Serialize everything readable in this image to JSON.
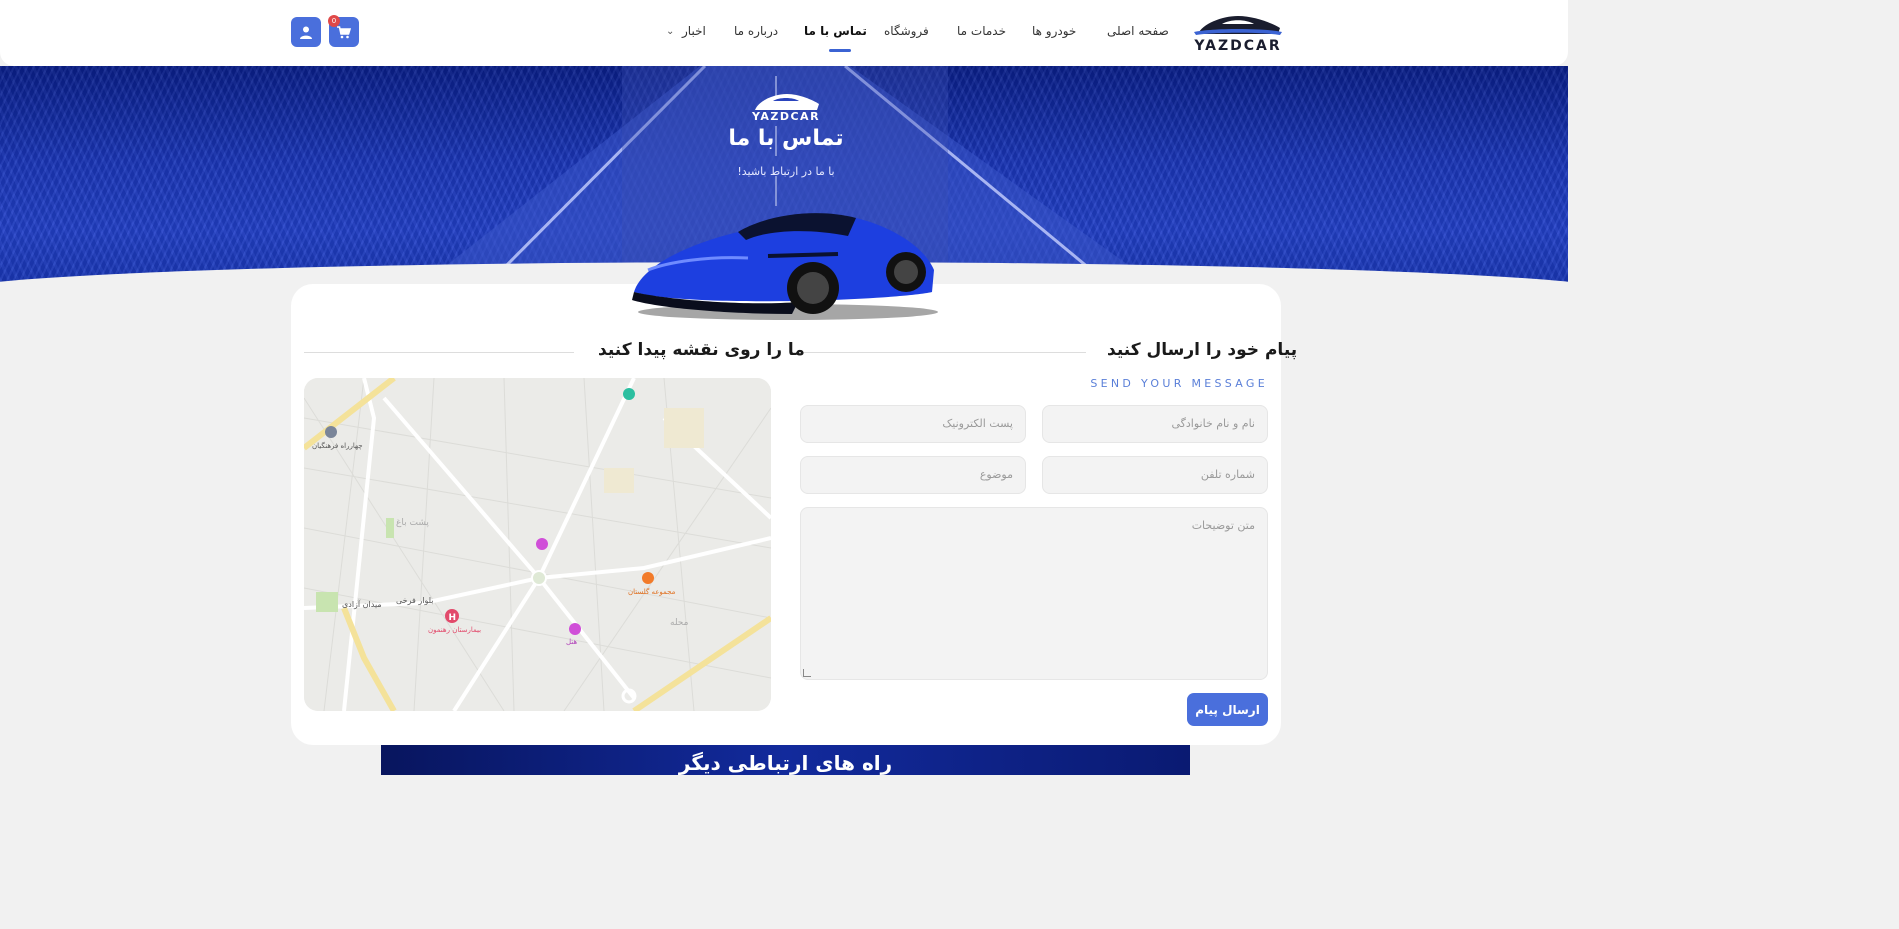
{
  "brand": {
    "name": "YAZDCAR"
  },
  "nav": {
    "items": [
      {
        "label": "صفحه اصلی"
      },
      {
        "label": "خودرو ها"
      },
      {
        "label": "خدمات ما"
      },
      {
        "label": "فروشگاه"
      },
      {
        "label": "تماس با ما",
        "active": true
      },
      {
        "label": "درباره ما"
      },
      {
        "label": "اخبار"
      }
    ],
    "cart_count": "0",
    "icons": {
      "cart": "cart-icon",
      "user": "user-icon",
      "dropdown": "chevron-down-icon"
    }
  },
  "hero": {
    "brand": "YAZDCAR",
    "title": "تماس با ما",
    "subtitle": "با ما در ارتباط باشید!"
  },
  "contact_form": {
    "title": "پیام خود را ارسال کنید",
    "subtitle": "SEND YOUR MESSAGE",
    "fields": {
      "full_name_placeholder": "نام و نام خانوادگی",
      "email_placeholder": "پست الکترونیک",
      "phone_placeholder": "شماره تلفن",
      "subject_placeholder": "موضوع",
      "message_placeholder": "متن توضیحات"
    },
    "submit_label": "ارسال پیام"
  },
  "map_section": {
    "title": "ما را روی نقشه پیدا کنید",
    "labels": {
      "square": "میدان آزادی",
      "boulevard": "بلوار فرخی",
      "hospital": "بیمارستان رهنمون",
      "garden": "پشت باغ",
      "shop": "مجموعه گلستان",
      "hotel": "هتل",
      "crossroad": "چهارراه فرهنگیان",
      "district": "محله"
    },
    "colors": {
      "accent": "#4a6fdc"
    }
  },
  "bottom_banner": {
    "title": "راه های ارتباطی دیگر"
  },
  "colors": {
    "primary": "#4a6fdc",
    "badge": "#e04848",
    "hero": "#1a36b8"
  }
}
